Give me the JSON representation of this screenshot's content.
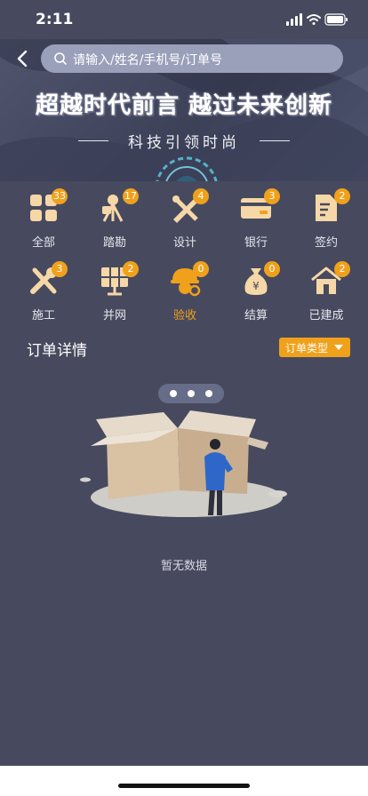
{
  "status_bar": {
    "time": "2:11"
  },
  "search": {
    "placeholder": "请输入/姓名/手机号/订单号"
  },
  "banner": {
    "slogan": "超越时代前言 越过未来创新",
    "subline": "科技引领时尚"
  },
  "categories": [
    {
      "label": "全部",
      "badge": "33",
      "icon": "grid-icon"
    },
    {
      "label": "踏勘",
      "badge": "17",
      "icon": "survey-icon"
    },
    {
      "label": "设计",
      "badge": "4",
      "icon": "design-tools-icon"
    },
    {
      "label": "银行",
      "badge": "3",
      "icon": "bank-card-icon"
    },
    {
      "label": "签约",
      "badge": "2",
      "icon": "contract-icon"
    },
    {
      "label": "施工",
      "badge": "3",
      "icon": "tools-icon"
    },
    {
      "label": "并网",
      "badge": "2",
      "icon": "solar-panel-icon"
    },
    {
      "label": "验收",
      "badge": "0",
      "icon": "worker-helmet-icon",
      "active": true
    },
    {
      "label": "结算",
      "badge": "0",
      "icon": "money-bag-icon"
    },
    {
      "label": "已建成",
      "badge": "2",
      "icon": "house-icon"
    }
  ],
  "orders": {
    "title": "订单详情",
    "filter_label": "订单类型",
    "empty_text": "暂无数据"
  },
  "colors": {
    "background": "#474a5e",
    "accent": "#f0a11c",
    "search_bg": "#9aa0ba"
  }
}
